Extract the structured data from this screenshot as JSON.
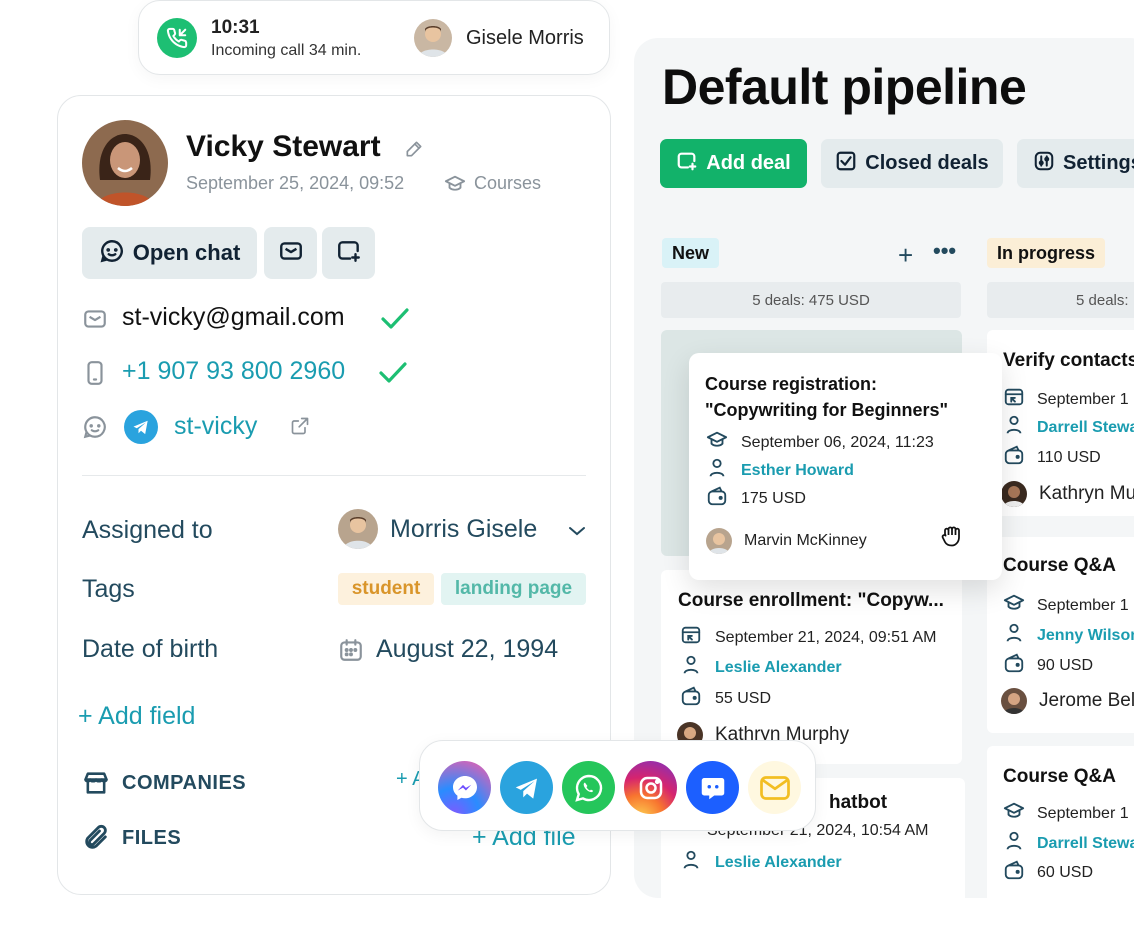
{
  "call": {
    "time": "10:31",
    "subtitle": "Incoming call 34 min.",
    "caller_name": "Gisele Morris"
  },
  "contact": {
    "name": "Vicky Stewart",
    "date": "September 25, 2024, 09:52",
    "course_label": "Courses",
    "open_chat_label": "Open chat",
    "email": "st-vicky@gmail.com",
    "phone": "+1 907 93 800 2960",
    "telegram": "st-vicky",
    "fields": {
      "assigned_label": "Assigned to",
      "assigned_value": "Morris Gisele",
      "tags_label": "Tags",
      "tags": [
        "student",
        "landing page"
      ],
      "dob_label": "Date of birth",
      "dob_value": "August 22, 1994"
    },
    "add_field": "+ Add field",
    "companies_label": "COMPANIES",
    "companies_add": "+ A",
    "files_label": "FILES",
    "files_add": "+ Add file"
  },
  "pipeline": {
    "title": "Default pipeline",
    "add_deal": "Add deal",
    "closed_deals": "Closed deals",
    "settings": "Settings",
    "stages": [
      {
        "name": "New",
        "summary": "5 deals: 475 USD",
        "color": "#d9f2f7"
      },
      {
        "name": "In progress",
        "summary": "5 deals:",
        "color": "#fbeed6"
      }
    ],
    "dragged_deal": {
      "title_line1": "Course registration:",
      "title_line2": "\"Copywriting for Beginners\"",
      "date": "September 06, 2024, 11:23",
      "contact": "Esther Howard",
      "amount": "175 USD",
      "owner": "Marvin McKinney"
    },
    "new_deals": [
      {
        "title": "Course enrollment: \"Copyw...",
        "date": "September 21, 2024, 09:51 AM",
        "contact": "Leslie Alexander",
        "amount": "55 USD",
        "owner": "Kathryn Murphy"
      },
      {
        "title": "hatbot",
        "date": "September 21, 2024, 10:54 AM",
        "contact": "Leslie Alexander"
      }
    ],
    "progress_deals": [
      {
        "title": "Verify contacts",
        "date": "September 1",
        "contact": "Darrell Stewa",
        "amount": "110 USD",
        "owner": "Kathryn Mu"
      },
      {
        "title": "Course Q&A",
        "date": "September 1",
        "contact": "Jenny Wilson",
        "amount": "90 USD",
        "owner": "Jerome Bell"
      },
      {
        "title": "Course Q&A",
        "date": "September 1",
        "contact": "Darrell Stewa",
        "amount": "60 USD"
      }
    ]
  },
  "messengers": [
    "messenger-icon",
    "telegram-icon",
    "whatsapp-icon",
    "instagram-icon",
    "chat-icon",
    "email-icon"
  ],
  "colors": {
    "accent": "#12b26a",
    "link": "#1a9cb0",
    "heading": "#234a5e"
  }
}
